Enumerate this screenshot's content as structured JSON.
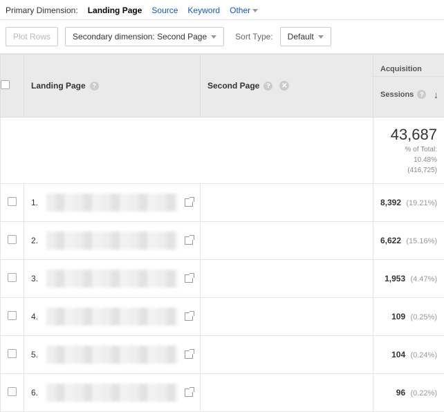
{
  "primary_dimension": {
    "label": "Primary Dimension:",
    "current": "Landing Page",
    "options": [
      "Source",
      "Keyword"
    ],
    "other_label": "Other"
  },
  "toolbar": {
    "plot_rows": "Plot Rows",
    "secondary_dimension": "Secondary dimension: Second Page",
    "sort_type_label": "Sort Type:",
    "sort_type_value": "Default"
  },
  "columns": {
    "landing_page": "Landing Page",
    "second_page": "Second Page",
    "acquisition": "Acquisition",
    "sessions": "Sessions"
  },
  "summary": {
    "sessions_total": "43,687",
    "pct_label": "% of Total:",
    "pct_value": "10.48%",
    "pct_base": "(416,725)"
  },
  "rows": [
    {
      "num": "1.",
      "sessions": "8,392",
      "pct": "(19.21%)"
    },
    {
      "num": "2.",
      "sessions": "6,622",
      "pct": "(15.16%)"
    },
    {
      "num": "3.",
      "sessions": "1,953",
      "pct": "(4.47%)"
    },
    {
      "num": "4.",
      "sessions": "109",
      "pct": "(0.25%)"
    },
    {
      "num": "5.",
      "sessions": "104",
      "pct": "(0.24%)"
    },
    {
      "num": "6.",
      "sessions": "96",
      "pct": "(0.22%)"
    }
  ]
}
